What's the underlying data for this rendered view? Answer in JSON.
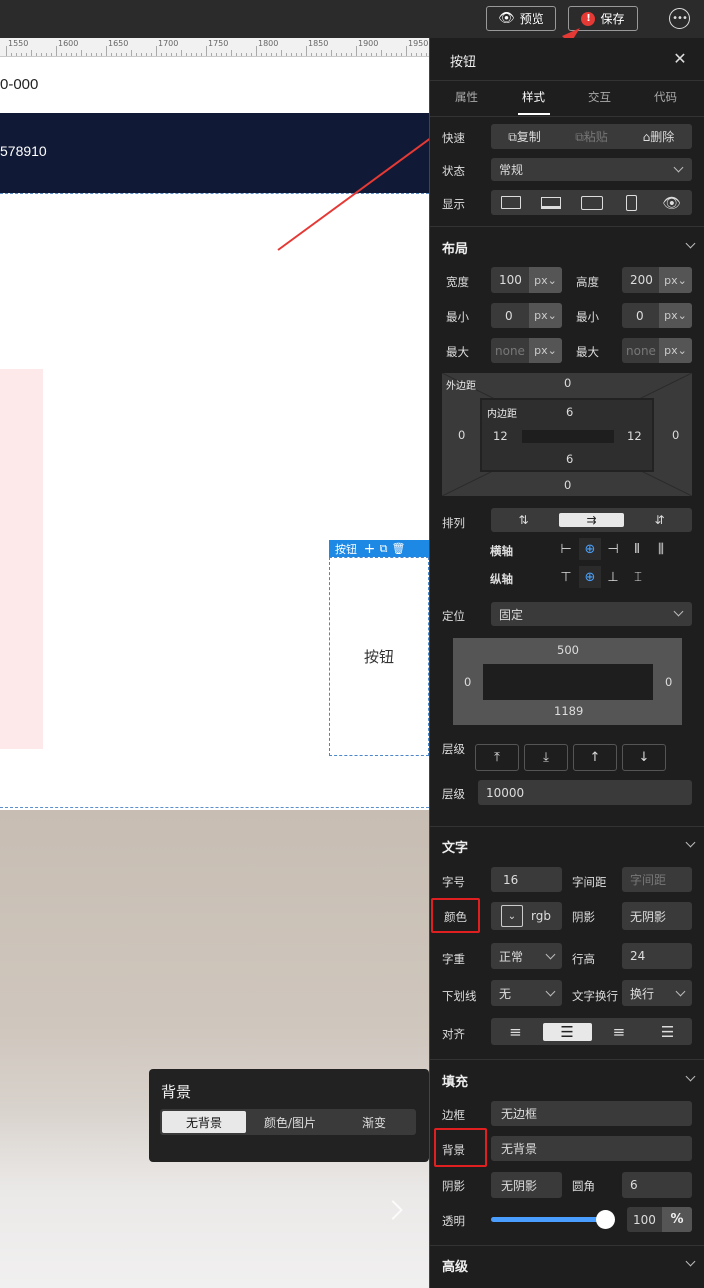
{
  "toolbar": {
    "preview_label": "预览",
    "save_label": "保存",
    "save_badge": "!"
  },
  "ruler": {
    "ticks": [
      "1550",
      "1600",
      "1650",
      "1700",
      "1750",
      "1800",
      "1850",
      "1900",
      "1950"
    ]
  },
  "canvas": {
    "phone_text": "0-000",
    "navy_text": "578910",
    "button_tag": "按钮",
    "button_text": "按钮"
  },
  "popup": {
    "title": "背景",
    "options": [
      "无背景",
      "颜色/图片",
      "渐变"
    ],
    "active": "无背景"
  },
  "panel": {
    "title": "按钮",
    "tabs": [
      "属性",
      "样式",
      "交互",
      "代码"
    ],
    "active_tab": "样式",
    "quick": {
      "label": "快速",
      "copy": "复制",
      "paste": "粘贴",
      "delete": "删除"
    },
    "state": {
      "label": "状态",
      "value": "常规"
    },
    "display": {
      "label": "显示"
    },
    "layout": {
      "title": "布局",
      "width_label": "宽度",
      "width": "100",
      "width_unit": "px",
      "height_label": "高度",
      "height": "200",
      "height_unit": "px",
      "min_label": "最小",
      "min_w": "0",
      "min_h": "0",
      "min_unit": "px",
      "max_label": "最大",
      "max_w": "none",
      "max_h": "none",
      "max_unit": "px",
      "margin_label": "外边距",
      "margin": {
        "top": "0",
        "right": "0",
        "bottom": "0",
        "left": "0"
      },
      "padding_label": "内边距",
      "padding": {
        "top": "6",
        "right": "12",
        "bottom": "6",
        "left": "12"
      },
      "arrange_label": "排列",
      "main_axis_label": "横轴",
      "cross_axis_label": "纵轴",
      "position_label": "定位",
      "position_value": "固定",
      "pos": {
        "top": "500",
        "right": "0",
        "bottom": "1189",
        "left": "0"
      },
      "zlevel_label": "层级",
      "zindex_label": "层级",
      "zindex": "10000"
    },
    "text": {
      "title": "文字",
      "size_label": "字号",
      "size": "16",
      "spacing_label": "字间距",
      "spacing_placeholder": "字间距",
      "color_label": "颜色",
      "color_value": "rgb",
      "shadow_label": "阴影",
      "shadow_value": "无阴影",
      "weight_label": "字重",
      "weight_value": "正常",
      "lineheight_label": "行高",
      "lineheight": "24",
      "underline_label": "下划线",
      "underline_value": "无",
      "wrap_label": "文字换行",
      "wrap_value": "换行",
      "align_label": "对齐"
    },
    "fill": {
      "title": "填充",
      "border_label": "边框",
      "border_value": "无边框",
      "bg_label": "背景",
      "bg_value": "无背景",
      "shadow_label": "阴影",
      "shadow_value": "无阴影",
      "radius_label": "圆角",
      "radius": "6",
      "opacity_label": "透明",
      "opacity": "100",
      "opacity_unit": "%",
      "opacity_fraction": 1.0
    },
    "advanced": {
      "title": "高级"
    }
  },
  "colors": {
    "accent": "#1e88e5",
    "highlight_red": "#e02020",
    "panel_bg": "#1e1e1e",
    "navy": "#101935"
  }
}
